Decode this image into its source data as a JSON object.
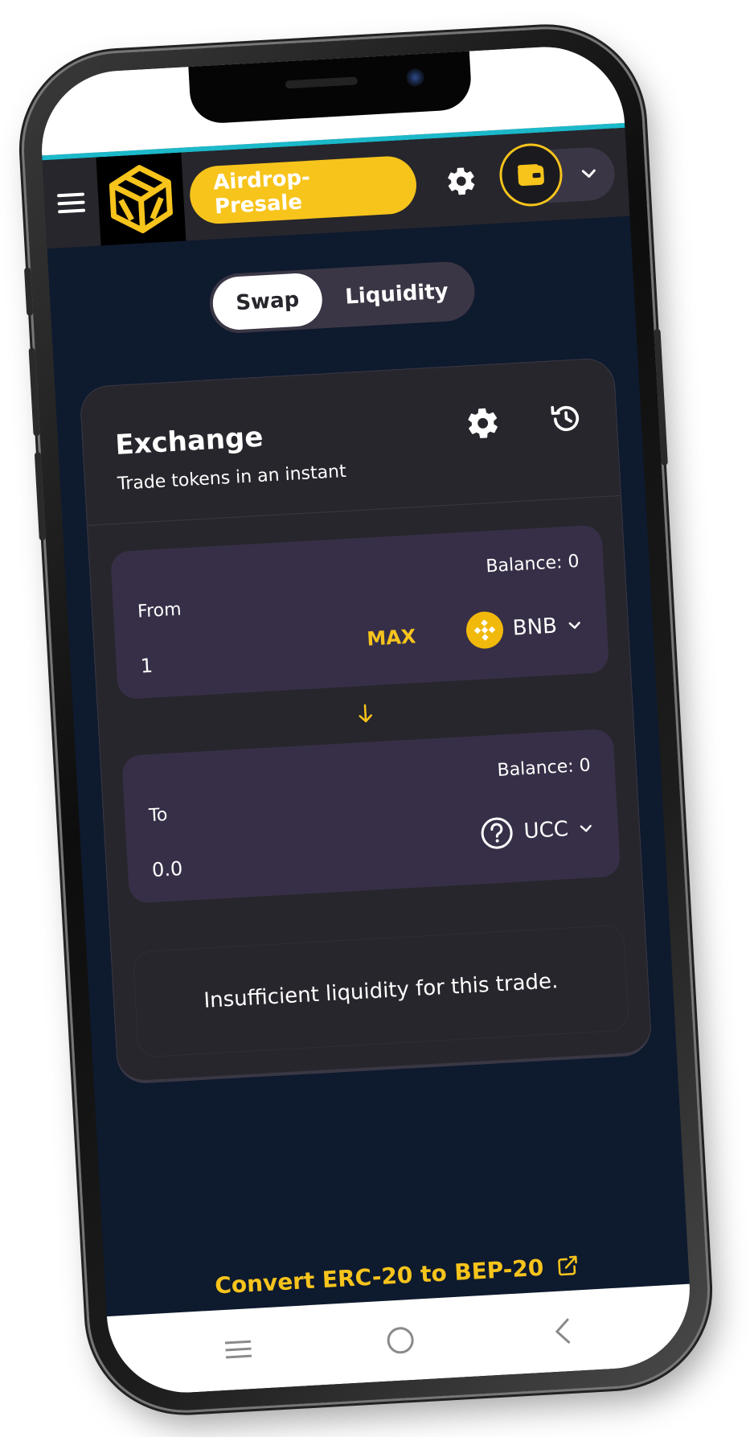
{
  "header": {
    "presale_label": "Airdrop-Presale"
  },
  "tabs": {
    "swap": "Swap",
    "liquidity": "Liquidity"
  },
  "card": {
    "title": "Exchange",
    "subtitle": "Trade tokens in an instant"
  },
  "from_panel": {
    "label": "From",
    "balance": "Balance: 0",
    "value": "1",
    "max_label": "MAX",
    "token": "BNB"
  },
  "to_panel": {
    "label": "To",
    "balance": "Balance: 0",
    "value": "0.0",
    "token": "UCC"
  },
  "notice": "Insufficient liquidity for this trade.",
  "footer_link": "Convert ERC-20 to BEP-20",
  "colors": {
    "accent": "#f7c41c",
    "header_bg": "#27262c",
    "page_bg": "#0e1a2e",
    "panel_bg": "#372f47",
    "teal": "#1bb9c9"
  },
  "icons": {
    "menu": "hamburger-icon",
    "logo": "cube-logo-icon",
    "settings": "gear-icon",
    "wallet": "wallet-icon",
    "history": "history-icon",
    "bnb": "bnb-token-icon",
    "unknown_token": "question-circle-icon",
    "external": "external-link-icon"
  }
}
